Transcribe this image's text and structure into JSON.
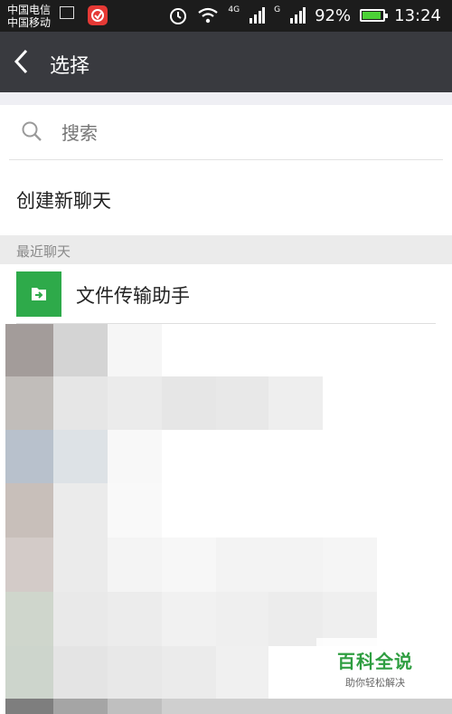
{
  "status_bar": {
    "carrier_1": "中国电信",
    "carrier_2": "中国移动",
    "network_1": "4G",
    "network_2": "G",
    "battery": "92%",
    "battery_level": 0.92,
    "time": "13:24",
    "icons": [
      "gallery-icon",
      "app-notification-icon",
      "alarm-icon",
      "wifi-icon",
      "signal-icon",
      "signal-icon",
      "battery-icon"
    ]
  },
  "nav": {
    "back_icon": "chevron-left-icon",
    "title": "选择"
  },
  "search": {
    "placeholder": "搜索",
    "icon": "search-icon"
  },
  "new_chat": {
    "label": "创建新聊天"
  },
  "recent": {
    "header": "最近聊天",
    "items": [
      {
        "label": "文件传输助手",
        "icon": "file-transfer-icon",
        "icon_color": "#2eaa4a"
      }
    ]
  },
  "watermark": {
    "title": "百科全说",
    "subtitle": "助你轻松解决"
  },
  "colors": {
    "nav_bg": "#393a3f",
    "status_bg": "#1c1c1c",
    "accent_green": "#2eaa4a",
    "section_bg": "#ebebeb"
  }
}
